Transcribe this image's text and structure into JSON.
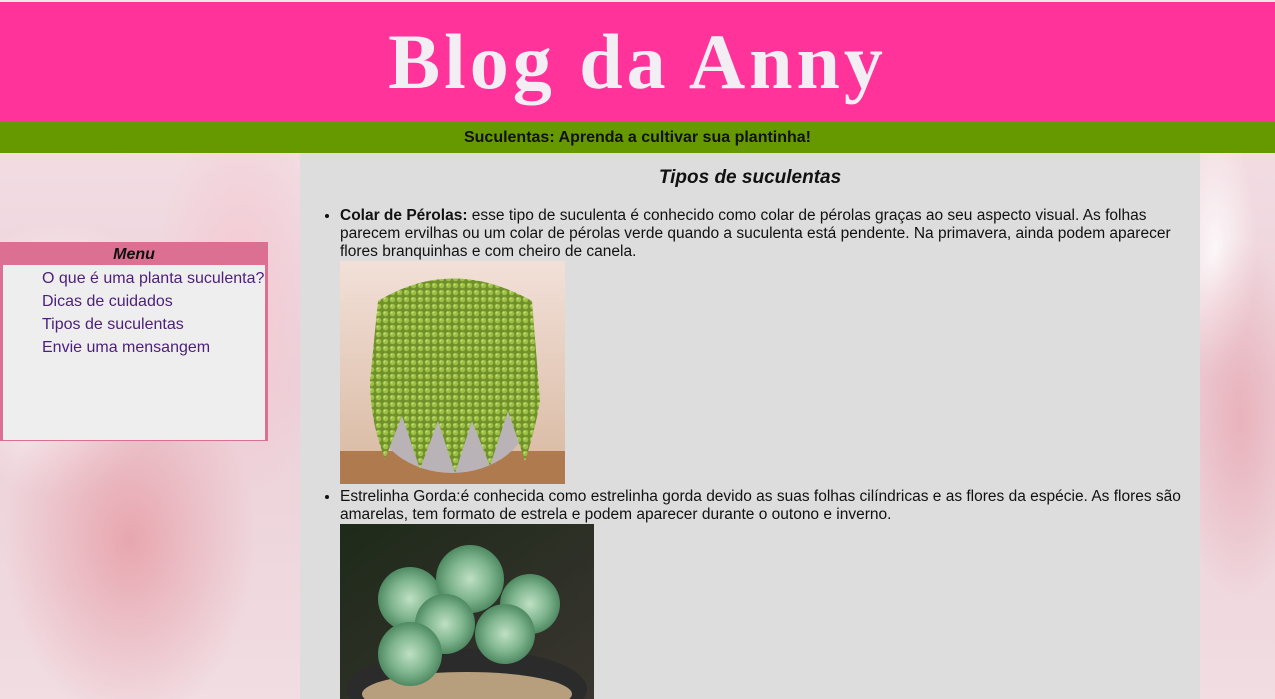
{
  "header": {
    "title": "Blog da Anny"
  },
  "subtitle": "Suculentas: Aprenda a cultivar sua plantinha!",
  "menu": {
    "title": "Menu",
    "items": [
      {
        "label": "O que é uma planta suculenta?"
      },
      {
        "label": "Dicas de cuidados"
      },
      {
        "label": "Tipos de suculentas"
      },
      {
        "label": "Envie uma mensangem"
      }
    ]
  },
  "main": {
    "heading": "Tipos de suculentas",
    "entries": [
      {
        "name": "Colar de Pérolas:",
        "text": " esse tipo de suculenta é conhecido como colar de pérolas graças ao seu aspecto visual. As folhas parecem ervilhas ou um colar de pérolas verde quando a suculenta está pendente. Na primavera, ainda podem aparecer flores branquinhas e com cheiro de canela.",
        "image_icon": "string-of-pearls-photo"
      },
      {
        "name": "",
        "text": "Estrelinha Gorda:é conhecida como estrelinha gorda devido as suas folhas cilíndricas e as flores da espécie. As flores são amarelas, tem formato de estrela e podem aparecer durante o outono e inverno.",
        "image_icon": "sedum-photo"
      }
    ]
  },
  "colors": {
    "header_bg": "#ff3399",
    "subbar_bg": "#669900",
    "menu_border": "#db7093",
    "content_bg": "#dddddd",
    "link": "#4b1f7a"
  }
}
